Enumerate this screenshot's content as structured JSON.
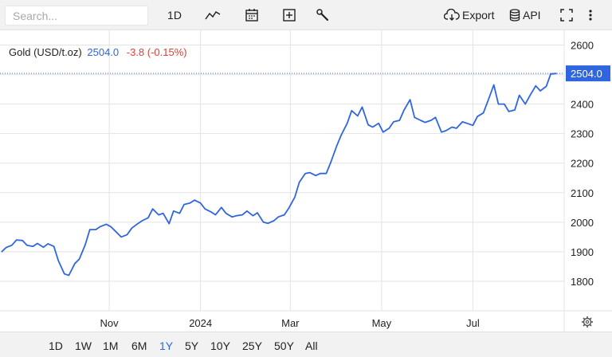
{
  "toolbar": {
    "search_placeholder": "Search...",
    "interval_label": "1D",
    "export_label": "Export",
    "api_label": "API",
    "icons": [
      "line-chart-icon",
      "calendar-icon",
      "plus-square-icon",
      "wrench-icon",
      "cloud-download-icon",
      "database-icon",
      "fullscreen-icon",
      "more-vertical-icon"
    ]
  },
  "legend": {
    "name": "Gold (USD/t.oz)",
    "price": "2504.0",
    "change": "-3.8 (-0.15%)"
  },
  "price_tag": "2504.0",
  "ranges": [
    "1D",
    "1W",
    "1M",
    "6M",
    "1Y",
    "5Y",
    "10Y",
    "25Y",
    "50Y",
    "All"
  ],
  "active_range": "1Y",
  "colors": {
    "line": "#2f66e0",
    "change_negative": "#d9413a",
    "grid": "#e3e3e3",
    "price_tag_bg": "#2f66e0"
  },
  "chart_data": {
    "type": "line",
    "title": "Gold (USD/t.oz)",
    "ylim": [
      1700,
      2650
    ],
    "yticks": [
      1800,
      1900,
      2000,
      2100,
      2200,
      2300,
      2400,
      2500,
      2600
    ],
    "xticks": [
      {
        "label": "Nov",
        "date": "2023-11-01"
      },
      {
        "label": "2024",
        "date": "2024-01-01"
      },
      {
        "label": "Mar",
        "date": "2024-03-01"
      },
      {
        "label": "May",
        "date": "2024-05-01"
      },
      {
        "label": "Jul",
        "date": "2024-07-01"
      }
    ],
    "xlim": [
      "2023-08-20",
      "2024-08-31"
    ],
    "last_value": 2504.0,
    "grid": true,
    "series": [
      {
        "x": [
          "2023-08-21",
          "2023-08-24",
          "2023-08-28",
          "2023-08-31",
          "2023-09-04",
          "2023-09-07",
          "2023-09-11",
          "2023-09-14",
          "2023-09-18",
          "2023-09-21",
          "2023-09-25",
          "2023-09-28",
          "2023-10-02",
          "2023-10-05",
          "2023-10-09",
          "2023-10-12",
          "2023-10-16",
          "2023-10-19",
          "2023-10-23",
          "2023-10-26",
          "2023-10-30",
          "2023-11-02",
          "2023-11-06",
          "2023-11-09",
          "2023-11-13",
          "2023-11-16",
          "2023-11-20",
          "2023-11-23",
          "2023-11-27",
          "2023-11-30",
          "2023-12-04",
          "2023-12-07",
          "2023-12-11",
          "2023-12-14",
          "2023-12-18",
          "2023-12-21",
          "2023-12-25",
          "2023-12-28",
          "2024-01-01",
          "2024-01-04",
          "2024-01-08",
          "2024-01-11",
          "2024-01-15",
          "2024-01-18",
          "2024-01-22",
          "2024-01-25",
          "2024-01-29",
          "2024-02-01",
          "2024-02-05",
          "2024-02-08",
          "2024-02-12",
          "2024-02-15",
          "2024-02-19",
          "2024-02-22",
          "2024-02-26",
          "2024-02-29",
          "2024-03-04",
          "2024-03-07",
          "2024-03-11",
          "2024-03-14",
          "2024-03-18",
          "2024-03-21",
          "2024-03-25",
          "2024-03-28",
          "2024-04-01",
          "2024-04-04",
          "2024-04-08",
          "2024-04-11",
          "2024-04-15",
          "2024-04-18",
          "2024-04-22",
          "2024-04-25",
          "2024-04-29",
          "2024-05-02",
          "2024-05-06",
          "2024-05-09",
          "2024-05-13",
          "2024-05-16",
          "2024-05-20",
          "2024-05-23",
          "2024-05-27",
          "2024-05-30",
          "2024-06-03",
          "2024-06-06",
          "2024-06-10",
          "2024-06-13",
          "2024-06-17",
          "2024-06-20",
          "2024-06-24",
          "2024-06-27",
          "2024-07-01",
          "2024-07-04",
          "2024-07-08",
          "2024-07-11",
          "2024-07-15",
          "2024-07-18",
          "2024-07-22",
          "2024-07-25",
          "2024-07-29",
          "2024-08-01",
          "2024-08-05",
          "2024-08-08",
          "2024-08-12",
          "2024-08-15",
          "2024-08-19",
          "2024-08-22",
          "2024-08-26"
        ],
        "y": [
          1899,
          1914,
          1922,
          1940,
          1938,
          1922,
          1918,
          1928,
          1915,
          1927,
          1918,
          1870,
          1825,
          1820,
          1860,
          1875,
          1924,
          1975,
          1975,
          1985,
          1993,
          1985,
          1965,
          1950,
          1958,
          1980,
          1995,
          2005,
          2015,
          2045,
          2025,
          2030,
          1995,
          2038,
          2030,
          2060,
          2065,
          2075,
          2065,
          2045,
          2035,
          2025,
          2050,
          2030,
          2018,
          2022,
          2025,
          2038,
          2022,
          2032,
          2000,
          1996,
          2005,
          2018,
          2025,
          2048,
          2085,
          2135,
          2165,
          2168,
          2158,
          2165,
          2165,
          2202,
          2258,
          2295,
          2335,
          2378,
          2360,
          2390,
          2330,
          2322,
          2335,
          2305,
          2318,
          2340,
          2345,
          2380,
          2415,
          2355,
          2345,
          2338,
          2345,
          2355,
          2305,
          2310,
          2322,
          2318,
          2340,
          2335,
          2328,
          2358,
          2370,
          2410,
          2465,
          2400,
          2400,
          2375,
          2380,
          2430,
          2400,
          2428,
          2462,
          2445,
          2460,
          2502,
          2504
        ]
      }
    ]
  }
}
